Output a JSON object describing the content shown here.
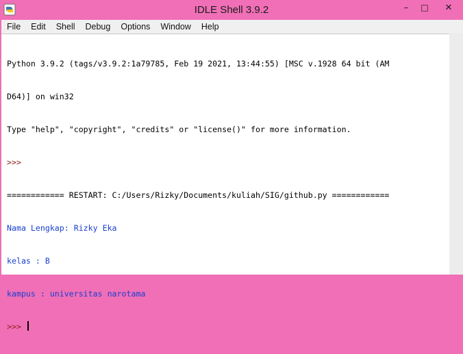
{
  "window": {
    "title": "IDLE Shell 3.9.2",
    "controls": {
      "minimize": "–",
      "maximize": "□",
      "close": "✕"
    }
  },
  "menu": {
    "items": [
      "File",
      "Edit",
      "Shell",
      "Debug",
      "Options",
      "Window",
      "Help"
    ]
  },
  "shell": {
    "lines": [
      {
        "text": "Python 3.9.2 (tags/v3.9.2:1a79785, Feb 19 2021, 13:44:55) [MSC v.1928 64 bit (AM",
        "kind": "plain"
      },
      {
        "text": "D64)] on win32",
        "kind": "plain"
      },
      {
        "text": "Type \"help\", \"copyright\", \"credits\" or \"license()\" for more information.",
        "kind": "plain"
      },
      {
        "text": ">>> ",
        "kind": "prompt"
      },
      {
        "text": "============ RESTART: C:/Users/Rizky/Documents/kuliah/SIG/github.py ============",
        "kind": "plain"
      },
      {
        "text": "Nama Lengkap: Rizky Eka",
        "kind": "out"
      },
      {
        "text": "kelas : B",
        "kind": "out"
      },
      {
        "text": "kampus : universitas narotama",
        "kind": "out"
      }
    ],
    "current_prompt": ">>> "
  },
  "colors": {
    "titlebar": "#f06fb6",
    "prompt": "#8b1d1d",
    "stdout": "#1a3fd0"
  },
  "icons": {
    "app": "idle-python-icon"
  }
}
